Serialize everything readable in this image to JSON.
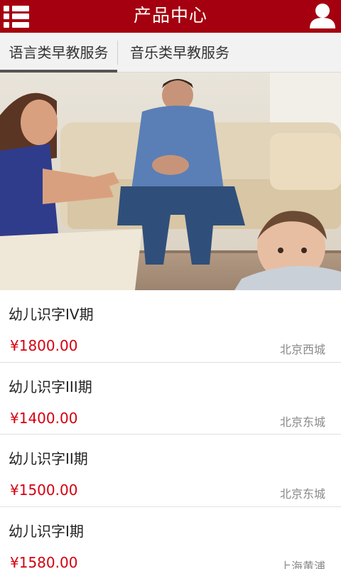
{
  "header": {
    "title": "产品中心",
    "menu_icon": "list-menu-icon",
    "user_icon": "user-icon",
    "bg_color": "#a5000f"
  },
  "tabs": [
    {
      "label": "语言类早教服务",
      "active": true
    },
    {
      "label": "音乐类早教服务",
      "active": false
    }
  ],
  "banner": {
    "slide_count": 2,
    "active_slide": 1
  },
  "products": [
    {
      "name": "幼儿识字IV期",
      "price": "¥1800.00",
      "location": "北京西城"
    },
    {
      "name": "幼儿识字III期",
      "price": "¥1400.00",
      "location": "北京东城"
    },
    {
      "name": "幼儿识字II期",
      "price": "¥1500.00",
      "location": "北京东城"
    },
    {
      "name": "幼儿识字I期",
      "price": "¥1580.00",
      "location": "上海黄浦"
    }
  ],
  "colors": {
    "price": "#d40010",
    "location": "#8a8a8a"
  }
}
